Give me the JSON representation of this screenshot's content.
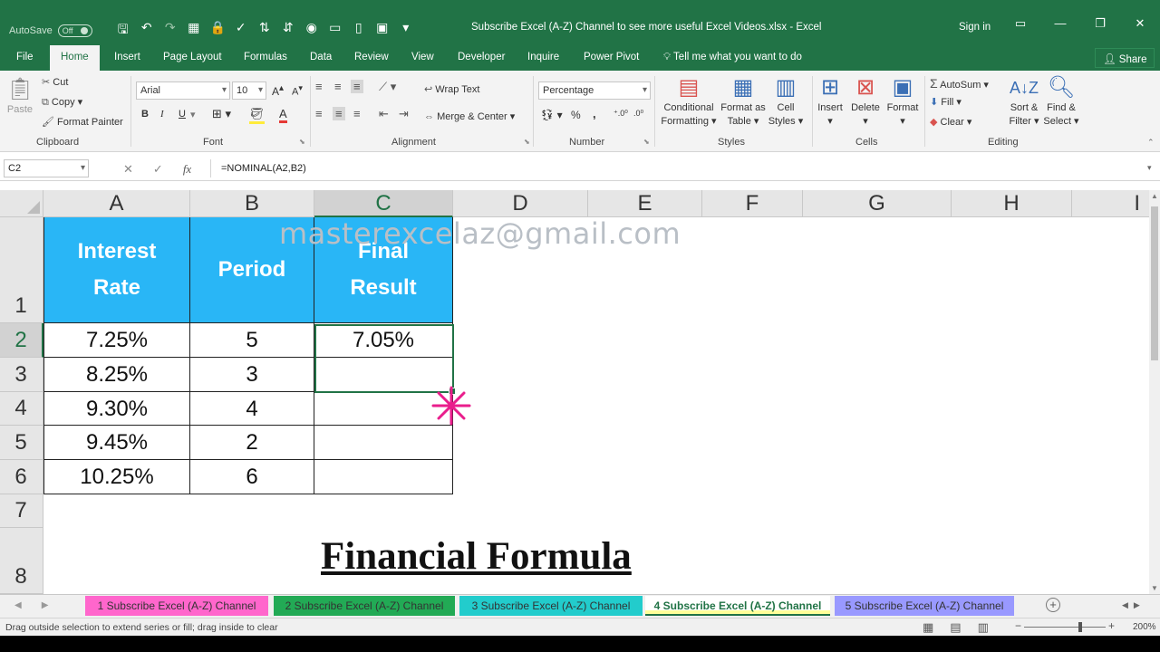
{
  "titlebar": {
    "autosave_label": "AutoSave",
    "autosave_state": "Off",
    "document_title": "Subscribe Excel (A-Z) Channel to see more useful Excel Videos.xlsx  -  Excel",
    "sign_in": "Sign in"
  },
  "tabs": [
    "File",
    "Home",
    "Insert",
    "Page Layout",
    "Formulas",
    "Data",
    "Review",
    "View",
    "Developer",
    "Inquire",
    "Power Pivot"
  ],
  "active_tab": "Home",
  "tell_me": "Tell me what you want to do",
  "share": "Share",
  "ribbon": {
    "clipboard": {
      "paste": "Paste",
      "cut": "Cut",
      "copy": "Copy",
      "format_painter": "Format Painter",
      "label": "Clipboard"
    },
    "font": {
      "name": "Arial",
      "size": "10",
      "bold": "B",
      "italic": "I",
      "underline": "U",
      "label": "Font"
    },
    "alignment": {
      "wrap_text": "Wrap Text",
      "merge_center": "Merge & Center",
      "label": "Alignment"
    },
    "number": {
      "format": "Percentage",
      "percent": "%",
      "comma": ",",
      "label": "Number"
    },
    "styles": {
      "conditional_formatting_1": "Conditional",
      "conditional_formatting_2": "Formatting",
      "format_table_1": "Format as",
      "format_table_2": "Table",
      "cell_styles_1": "Cell",
      "cell_styles_2": "Styles",
      "label": "Styles"
    },
    "cells": {
      "insert": "Insert",
      "delete": "Delete",
      "format": "Format",
      "label": "Cells"
    },
    "editing": {
      "autosum": "AutoSum",
      "fill": "Fill",
      "clear": "Clear",
      "sort_filter_1": "Sort &",
      "sort_filter_2": "Filter",
      "find_select_1": "Find &",
      "find_select_2": "Select",
      "label": "Editing"
    }
  },
  "formula_bar": {
    "name_box": "C2",
    "fx": "fx",
    "formula": "=NOMINAL(A2,B2)"
  },
  "columns": [
    "A",
    "B",
    "C",
    "D",
    "E",
    "F",
    "G",
    "H",
    "I"
  ],
  "rows": [
    "1",
    "2",
    "3",
    "4",
    "5",
    "6",
    "7",
    "8"
  ],
  "table": {
    "headers": {
      "a_line1": "Interest",
      "a_line2": "Rate",
      "b": "Period",
      "c_line1": "Final",
      "c_line2": "Result"
    },
    "data": [
      {
        "rate": "7.25%",
        "period": "5",
        "result": "7.05%"
      },
      {
        "rate": "8.25%",
        "period": "3",
        "result": ""
      },
      {
        "rate": "9.30%",
        "period": "4",
        "result": ""
      },
      {
        "rate": "9.45%",
        "period": "2",
        "result": ""
      },
      {
        "rate": "10.25%",
        "period": "6",
        "result": ""
      }
    ]
  },
  "watermark": "masterexcelaz@gmail.com",
  "big_title": "Financial Formula",
  "sheets": [
    {
      "name": "1 Subscribe Excel (A-Z) Channel",
      "color": "#ff66cc"
    },
    {
      "name": "2 Subscribe Excel (A-Z) Channel",
      "color": "#22aa55"
    },
    {
      "name": "3 Subscribe Excel (A-Z) Channel",
      "color": "#22cccc"
    },
    {
      "name": "4 Subscribe Excel (A-Z) Channel",
      "color": "#ffff99"
    },
    {
      "name": "5 Subscribe Excel (A-Z) Channel",
      "color": "#9999ff"
    }
  ],
  "active_sheet": "4 Subscribe Excel (A-Z) Channel",
  "status": {
    "message": "Drag outside selection to extend series or fill; drag inside to clear",
    "zoom": "200%"
  },
  "colors": {
    "excel_green": "#217346",
    "header_fill": "#29b6f6",
    "crosshair": "#e91e8c"
  }
}
